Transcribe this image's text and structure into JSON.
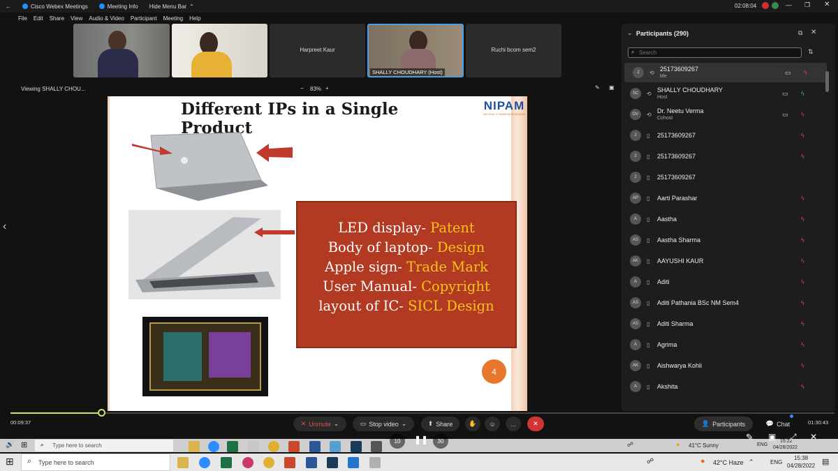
{
  "titlebar": {
    "app": "Cisco Webex Meetings",
    "meeting_info": "Meeting Info",
    "hide_menu": "Hide Menu Bar",
    "time": "02:08:04"
  },
  "menu": [
    "File",
    "Edit",
    "Share",
    "View",
    "Audio & Video",
    "Participant",
    "Meeting",
    "Help"
  ],
  "thumbs": [
    "Harpreet Kaur",
    "SHALLY CHOUDHARY (Host)",
    "Ruchi bcom sem2"
  ],
  "viewbar": {
    "viewing": "Viewing SHALLY CHOU...",
    "zoom": "83%",
    "minus": "−",
    "plus": "+"
  },
  "slide": {
    "title": "Different IPs in a Single Product",
    "logo": "NIPAM",
    "logo_sub": "NATIONAL IP AWARENESS MISSION",
    "lines": [
      {
        "a": "LED display- ",
        "b": "Patent"
      },
      {
        "a": "Body of laptop- ",
        "b": "Design"
      },
      {
        "a": "Apple sign- ",
        "b": "Trade Mark"
      },
      {
        "a": "User Manual- ",
        "b": "Copyright"
      },
      {
        "a": "layout of IC- ",
        "b": "SICL Design"
      }
    ],
    "page": "4",
    "accent": "#b23a22",
    "highlight": "#f5c518"
  },
  "panel": {
    "title": "Participants (290)",
    "search_placeholder": "Search",
    "rows": [
      {
        "av": "2",
        "name": "25173609267",
        "sub": "Me",
        "cam": true,
        "mic": "red"
      },
      {
        "av": "SC",
        "name": "SHALLY CHOUDHARY",
        "sub": "Host",
        "cam": true,
        "mic": "green"
      },
      {
        "av": "DV",
        "name": "Dr. Neetu Verma",
        "sub": "Cohost",
        "cam": true,
        "mic": "red"
      },
      {
        "av": "2",
        "name": "25173609267",
        "sub": "",
        "cam": false,
        "mic": "red"
      },
      {
        "av": "2",
        "name": "25173609267",
        "sub": "",
        "cam": false,
        "mic": "red"
      },
      {
        "av": "2",
        "name": "25173609267",
        "sub": "",
        "cam": false,
        "mic": ""
      },
      {
        "av": "AP",
        "name": "Aarti Parashar",
        "sub": "",
        "cam": false,
        "mic": "red"
      },
      {
        "av": "A",
        "name": "Aastha",
        "sub": "",
        "cam": false,
        "mic": "red"
      },
      {
        "av": "AS",
        "name": "Aastha Sharma",
        "sub": "",
        "cam": false,
        "mic": "red"
      },
      {
        "av": "AK",
        "name": "AAYUSHI KAUR",
        "sub": "",
        "cam": false,
        "mic": "red"
      },
      {
        "av": "A",
        "name": "Aditi",
        "sub": "",
        "cam": false,
        "mic": "red"
      },
      {
        "av": "AS",
        "name": "Aditi Pathania BSc NM Sem4",
        "sub": "",
        "cam": false,
        "mic": "red"
      },
      {
        "av": "AS",
        "name": "Aditi Sharma",
        "sub": "",
        "cam": false,
        "mic": "red"
      },
      {
        "av": "A",
        "name": "Agrima",
        "sub": "",
        "cam": false,
        "mic": "red"
      },
      {
        "av": "AK",
        "name": "Aishwarya Kohli",
        "sub": "",
        "cam": false,
        "mic": "red"
      },
      {
        "av": "A",
        "name": "Akshita",
        "sub": "",
        "cam": false,
        "mic": "red"
      }
    ]
  },
  "playback": {
    "elapsed": "00:09:37",
    "total": "01:30:43",
    "progress": 0.11
  },
  "controls": {
    "unmute": "Unmute",
    "stop_video": "Stop video",
    "share": "Share",
    "participants": "Participants",
    "chat": "Chat",
    "skip_back": "10",
    "skip_fwd": "30"
  },
  "inner_taskbar": {
    "search": "Type here to search",
    "weather": "41°C Sunny",
    "lang": "ENG",
    "time": "15:22",
    "date": "04/28/2022"
  },
  "taskbar": {
    "search": "Type here to search",
    "weather": "42°C Haze",
    "lang": "ENG",
    "time": "15:38",
    "date": "04/28/2022"
  }
}
